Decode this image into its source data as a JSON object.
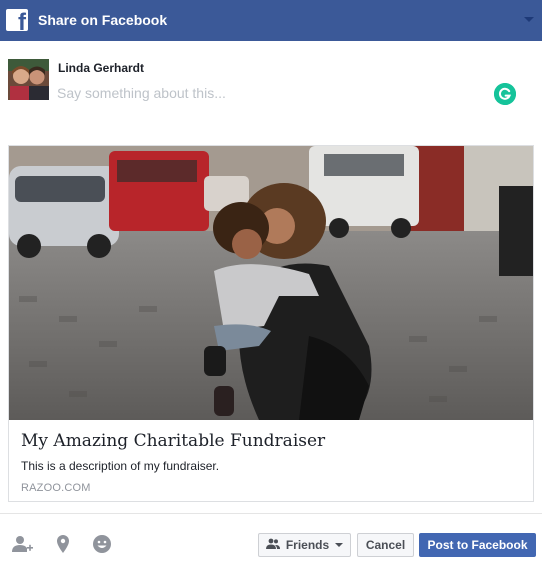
{
  "header": {
    "title": "Share on Facebook",
    "logo_letter": "f",
    "brand_color": "#3b5998"
  },
  "composer": {
    "user_name": "Linda Gerhardt",
    "placeholder": "Say something about this...",
    "grammarly_color": "#15c39a"
  },
  "link_card": {
    "title": "My Amazing Charitable Fundraiser",
    "description": "This is a description of my fundraiser.",
    "domain": "RAZOO.COM"
  },
  "footer": {
    "icons": [
      "tag-friends-icon",
      "location-pin-icon",
      "emoji-icon"
    ],
    "audience_label": "Friends",
    "cancel_label": "Cancel",
    "post_label": "Post to Facebook",
    "post_color": "#4267b2"
  }
}
